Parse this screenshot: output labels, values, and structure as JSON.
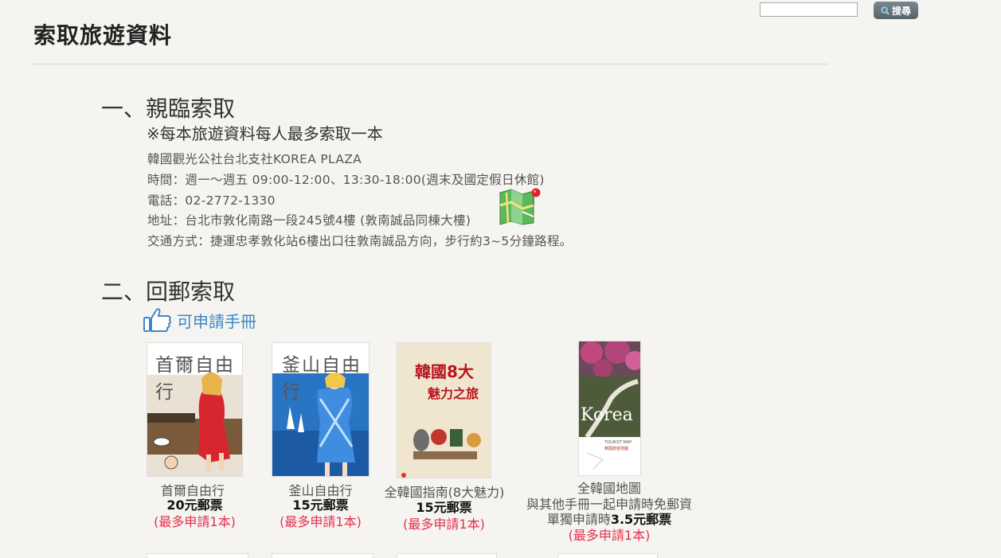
{
  "search": {
    "placeholder": "",
    "button_label": "搜尋"
  },
  "page_title": "索取旅遊資料",
  "section1": {
    "heading": "一、親臨索取",
    "note": "※每本旅遊資料每人最多索取一本",
    "lines": [
      "韓國觀光公社台北支社KOREA PLAZA",
      "時間：週一～週五 09:00-12:00、13:30-18:00(週末及國定假日休館)",
      "電話：02-2772-1330",
      "地址：台北市敦化南路一段245號4樓 (敦南誠品同棟大樓)",
      "交通方式：捷運忠孝敦化站6樓出口往敦南誠品方向，步行約3~5分鐘路程。"
    ]
  },
  "section2": {
    "heading": "二、回郵索取",
    "apply_label": "可申請手冊",
    "books": [
      {
        "cover_title": "首爾自由行",
        "name": "首爾自由行",
        "price": "20元郵票",
        "limit": "(最多申請1本)"
      },
      {
        "cover_title": "釜山自由行",
        "name": "釜山自由行",
        "price": "15元郵票",
        "limit": "(最多申請1本)"
      },
      {
        "cover_title_line1": "韓國8大",
        "cover_title_line2": "魅力之旅",
        "name": "全韓國指南(8大魅力)",
        "price": "15元郵票",
        "limit": "(最多申請1本)"
      },
      {
        "cover_title": "Korea",
        "cover_subtitle": "TOURIST MAP",
        "cover_subtitle2": "韓國旅遊地圖",
        "name": "全韓國地圖",
        "note": "與其他手冊一起申請時免郵資",
        "price_prefix": "單獨申請時",
        "price": "3.5元郵票",
        "limit": "(最多申請1本)"
      }
    ]
  },
  "colors": {
    "background": "#f5f4f0",
    "link_blue": "#3e87c6",
    "limit_red": "#e5304f",
    "search_button": "#5f6c76"
  },
  "icons": [
    "search-icon",
    "map-pin-icon",
    "thumbs-up-icon"
  ]
}
